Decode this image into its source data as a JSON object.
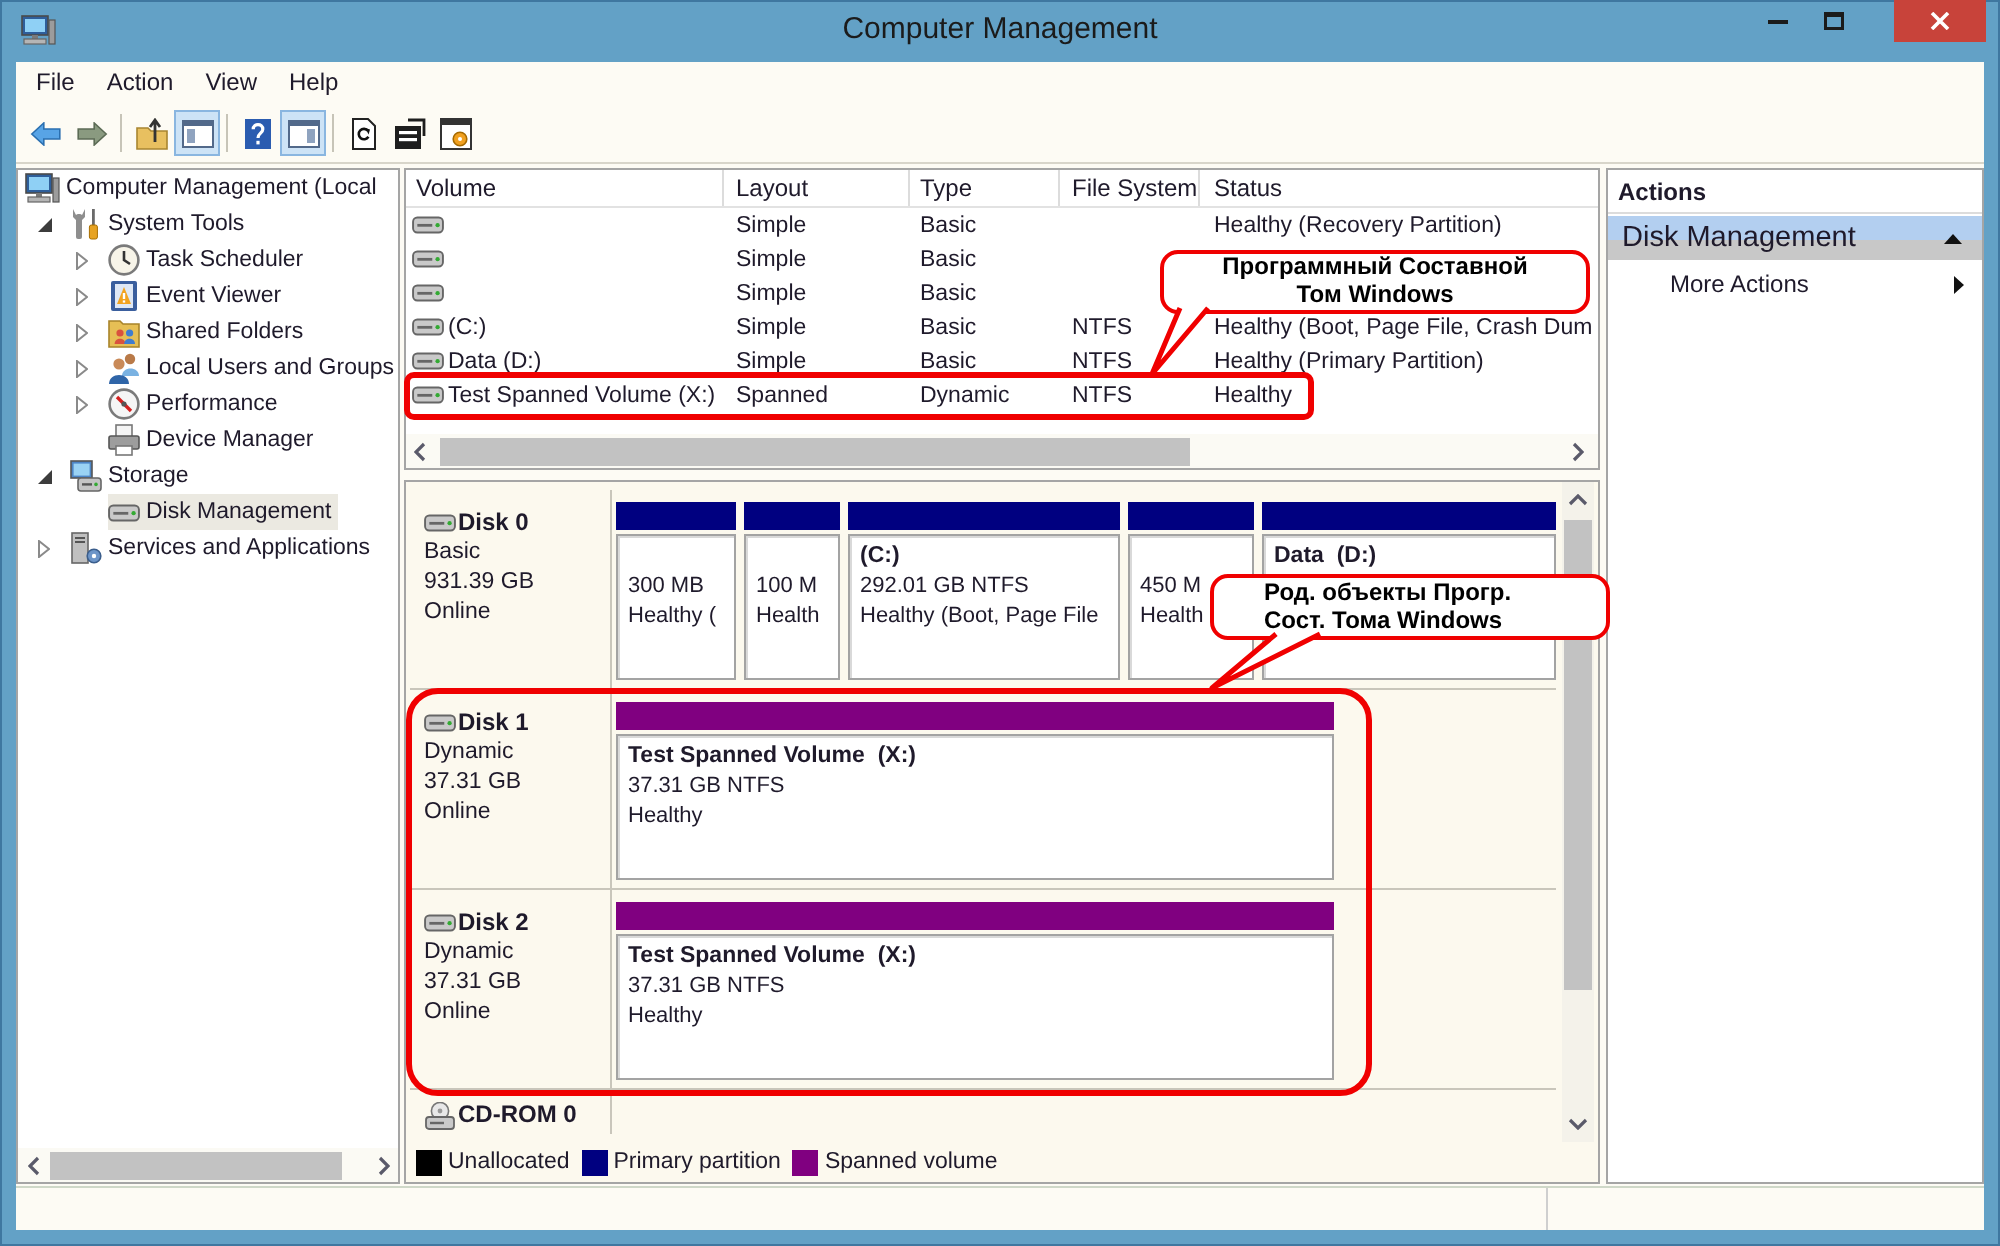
{
  "window": {
    "title": "Computer Management"
  },
  "menu": [
    {
      "label": "File"
    },
    {
      "label": "Action"
    },
    {
      "label": "View"
    },
    {
      "label": "Help"
    }
  ],
  "toolbar": [
    {
      "kind": "back",
      "pressed": false
    },
    {
      "kind": "forward",
      "pressed": false
    },
    {
      "kind": "separator"
    },
    {
      "kind": "up",
      "pressed": false
    },
    {
      "kind": "tree",
      "pressed": true
    },
    {
      "kind": "separator"
    },
    {
      "kind": "help",
      "pressed": false
    },
    {
      "kind": "action_pane",
      "pressed": true
    },
    {
      "kind": "separator"
    },
    {
      "kind": "refresh",
      "pressed": false
    },
    {
      "kind": "properties",
      "pressed": false
    },
    {
      "kind": "export",
      "pressed": false
    }
  ],
  "tree": [
    {
      "label": "Computer Management (Local",
      "kind": "computer",
      "selected": false,
      "children": [
        {
          "label": "System Tools",
          "kind": "tools",
          "expanded": true,
          "selected": false,
          "children": [
            {
              "label": "Task Scheduler",
              "kind": "clock",
              "expanded": false,
              "selected": false
            },
            {
              "label": "Event Viewer",
              "kind": "log",
              "expanded": false,
              "selected": false
            },
            {
              "label": "Shared Folders",
              "kind": "folder",
              "expanded": false,
              "selected": false
            },
            {
              "label": "Local Users and Groups",
              "kind": "users",
              "expanded": false,
              "selected": false
            },
            {
              "label": "Performance",
              "kind": "gauge",
              "expanded": false,
              "selected": false
            },
            {
              "label": "Device Manager",
              "kind": "device",
              "selected": false
            }
          ]
        },
        {
          "label": "Storage",
          "kind": "storage",
          "expanded": true,
          "selected": false,
          "children": [
            {
              "label": "Disk Management",
              "kind": "drive",
              "selected": true
            }
          ]
        },
        {
          "label": "Services and Applications",
          "kind": "services",
          "expanded": false,
          "selected": false
        }
      ]
    }
  ],
  "volumes": {
    "columns": [
      "Volume",
      "Layout",
      "Type",
      "File System",
      "Status"
    ],
    "rows": [
      {
        "layout": "Simple",
        "type": "Basic",
        "status": "Healthy (Recovery Partition)"
      },
      {
        "layout": "Simple",
        "type": "Basic"
      },
      {
        "layout": "Simple",
        "type": "Basic"
      },
      {
        "volume": "(C:)",
        "layout": "Simple",
        "type": "Basic",
        "file_system": "NTFS",
        "status": "Healthy (Boot, Page File, Crash Dum"
      },
      {
        "volume": "Data (D:)",
        "layout": "Simple",
        "type": "Basic",
        "file_system": "NTFS",
        "status": "Healthy (Primary Partition)"
      },
      {
        "volume": "Test Spanned Volume (X:)",
        "layout": "Spanned",
        "type": "Dynamic",
        "file_system": "NTFS",
        "status": "Healthy"
      }
    ]
  },
  "disks": [
    {
      "kind": "disk",
      "name": "Disk 0",
      "info": [
        "Basic",
        "931.39 GB",
        "Online"
      ],
      "partitions": [
        {
          "color": "#000080",
          "lines": [
            "300 MB",
            "Healthy ("
          ]
        },
        {
          "color": "#000080",
          "lines": [
            "100 M",
            "Health"
          ]
        },
        {
          "color": "#000080",
          "title": "(C:)",
          "lines": [
            "292.01 GB NTFS",
            "Healthy (Boot, Page File"
          ]
        },
        {
          "color": "#000080",
          "lines": [
            "450 M",
            "Health"
          ]
        },
        {
          "color": "#000080",
          "title": "Data  (D:)"
        }
      ]
    },
    {
      "kind": "disk",
      "name": "Disk 1",
      "info": [
        "Dynamic",
        "37.31 GB",
        "Online"
      ],
      "partitions": [
        {
          "color": "#800080",
          "title": "Test Spanned Volume  (X:)",
          "lines": [
            "37.31 GB NTFS",
            "Healthy"
          ]
        }
      ]
    },
    {
      "kind": "disk",
      "name": "Disk 2",
      "info": [
        "Dynamic",
        "37.31 GB",
        "Online"
      ],
      "partitions": [
        {
          "color": "#800080",
          "title": "Test Spanned Volume  (X:)",
          "lines": [
            "37.31 GB NTFS",
            "Healthy"
          ]
        }
      ]
    },
    {
      "kind": "cdrom",
      "name": "CD-ROM 0"
    }
  ],
  "legend": [
    {
      "label": "Unallocated",
      "color": "#000000"
    },
    {
      "label": "Primary partition",
      "color": "#000080"
    },
    {
      "label": "Spanned volume",
      "color": "#800080"
    }
  ],
  "actions": {
    "title": "Actions",
    "items": [
      {
        "kind": "section",
        "label": "Disk Management",
        "expanded": true
      },
      {
        "kind": "submenu",
        "label": "More Actions"
      }
    ]
  },
  "annotations": [
    {
      "kind": "outline"
    },
    {
      "kind": "callout",
      "lines": [
        "Программный Составной",
        "Том Windows"
      ]
    },
    {
      "kind": "outline"
    },
    {
      "kind": "callout",
      "lines": [
        "Род. объекты Прогр.",
        "Сост. Тома Windows"
      ]
    }
  ]
}
